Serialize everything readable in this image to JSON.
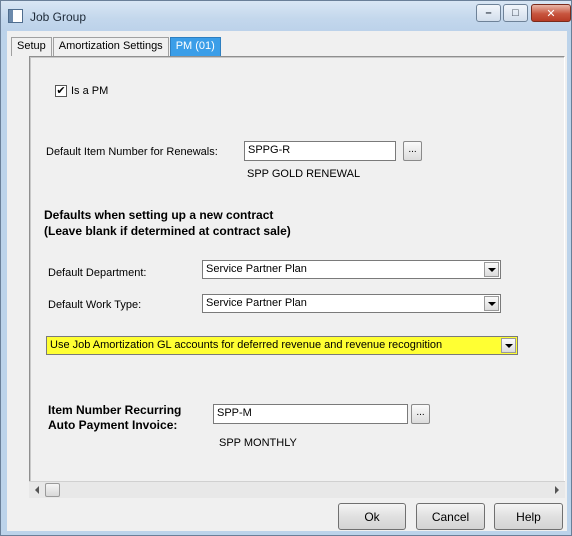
{
  "window": {
    "title": "Job Group",
    "min_glyph": "–",
    "max_glyph": "□",
    "close_glyph": "✕"
  },
  "tabs": [
    {
      "label": "Setup",
      "active": false
    },
    {
      "label": "Amortization Settings",
      "active": false
    },
    {
      "label": "PM (01)",
      "active": true
    }
  ],
  "pm": {
    "is_pm_label": "Is a PM",
    "is_pm_checked": true,
    "is_pm_mark": "✔",
    "renewal_label": "Default Item Number for Renewals:",
    "renewal_value": "SPPG-R",
    "renewal_desc": "SPP GOLD RENEWAL",
    "browse_label": "...",
    "defaults_heading_1": "Defaults when setting up a new contract",
    "defaults_heading_2": "(Leave blank if determined at contract sale)",
    "dept_label": "Default Department:",
    "dept_value": "Service Partner Plan",
    "worktype_label": "Default Work Type:",
    "worktype_value": "Service Partner Plan",
    "gl_option_value": "Use Job Amortization GL accounts for deferred revenue and revenue recognition",
    "recurring_label_1": "Item Number Recurring",
    "recurring_label_2": "Auto Payment Invoice:",
    "recurring_value": "SPP-M",
    "recurring_desc": "SPP MONTHLY"
  },
  "buttons": {
    "ok": "Ok",
    "cancel": "Cancel",
    "help": "Help"
  },
  "colors": {
    "active_tab": "#3b9ee8",
    "highlight": "#ffff33"
  }
}
